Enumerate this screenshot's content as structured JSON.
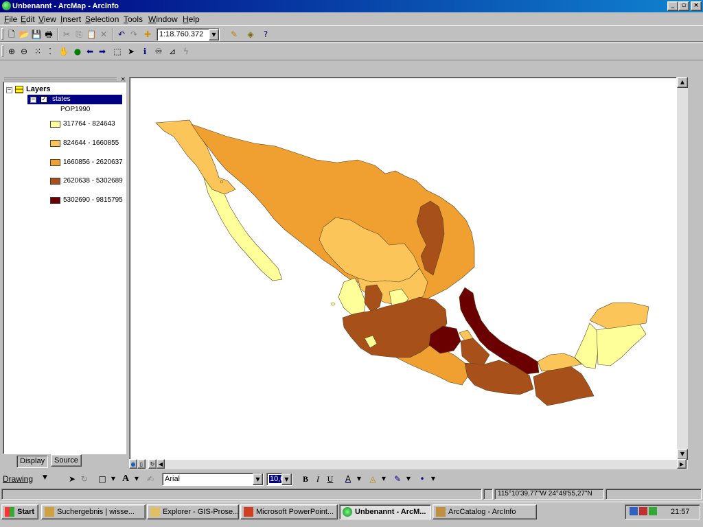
{
  "window": {
    "title": "Unbenannt - ArcMap - ArcInfo",
    "controls": [
      "_",
      "▫",
      "×"
    ]
  },
  "menu": [
    "File",
    "Edit",
    "View",
    "Insert",
    "Selection",
    "Tools",
    "Window",
    "Help"
  ],
  "toolbar": {
    "scale": "1:18.760.372"
  },
  "toc": {
    "root": "Layers",
    "layer": "states",
    "field": "POP1990",
    "classes": [
      {
        "label": "317764 - 824643",
        "color": "#ffff99"
      },
      {
        "label": "824644 - 1660855",
        "color": "#fcc55a"
      },
      {
        "label": "1660856 - 2620637",
        "color": "#f0a030"
      },
      {
        "label": "2620638 - 5302689",
        "color": "#a8501a"
      },
      {
        "label": "5302690 - 9815795",
        "color": "#6b0000"
      }
    ],
    "tabs": [
      "Display",
      "Source"
    ]
  },
  "drawing": {
    "menu": "Drawing",
    "font": "Arial",
    "size": "10,0"
  },
  "status": {
    "coords": "115°10'39,77\"W  24°49'55,27\"N"
  },
  "taskbar": {
    "start": "Start",
    "tasks": [
      "Suchergebnis | wisse...",
      "Explorer - GIS-Prose...",
      "Microsoft PowerPoint...",
      "Unbenannt - ArcM...",
      "ArcCatalog - ArcInfo"
    ],
    "clock": "21:57"
  }
}
